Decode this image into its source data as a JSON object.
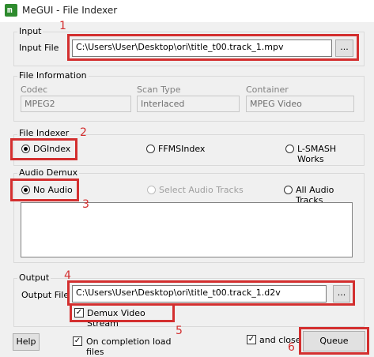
{
  "window": {
    "title": "MeGUI - File Indexer",
    "app_icon_glyph": "m"
  },
  "input": {
    "group_label": "Input",
    "file_label": "Input File",
    "file_value": "C:\\Users\\User\\Desktop\\ori\\title_t00.track_1.mpv",
    "browse_label": "..."
  },
  "file_info": {
    "group_label": "File Information",
    "codec_label": "Codec",
    "codec_value": "MPEG2",
    "scan_label": "Scan Type",
    "scan_value": "Interlaced",
    "container_label": "Container",
    "container_value": "MPEG Video"
  },
  "indexer": {
    "group_label": "File Indexer",
    "options": [
      "DGIndex",
      "FFMSIndex",
      "L-SMASH Works"
    ],
    "selected": "DGIndex"
  },
  "audio": {
    "group_label": "Audio Demux",
    "options": [
      "No Audio",
      "Select Audio Tracks",
      "All Audio Tracks"
    ],
    "selected": "No Audio"
  },
  "output": {
    "group_label": "Output",
    "file_label": "Output File",
    "file_value": "C:\\Users\\User\\Desktop\\ori\\title_t00.track_1.d2v",
    "browse_label": "...",
    "demux_video_label": "Demux Video Stream",
    "demux_video_checked": true
  },
  "footer": {
    "help_label": "Help",
    "on_completion_label": "On completion load files",
    "on_completion_checked": true,
    "and_close_label": "and close",
    "and_close_checked": true,
    "queue_label": "Queue"
  },
  "annotations": [
    "1",
    "2",
    "3",
    "4",
    "5",
    "6"
  ],
  "colors": {
    "highlight": "#d32f2f",
    "background": "#f0f0f0",
    "app_icon": "#2e8b2e"
  }
}
